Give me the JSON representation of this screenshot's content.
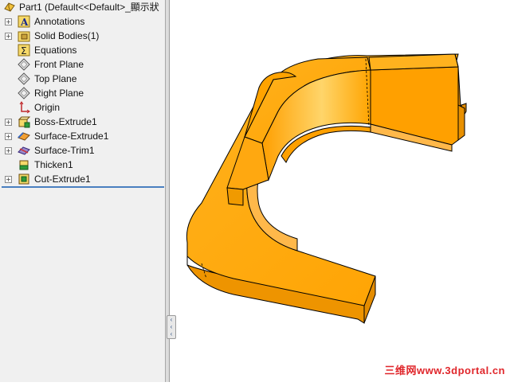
{
  "feature_tree": {
    "root": {
      "label": "Part1  (Default<<Default>_顯示狀"
    },
    "items": [
      {
        "label": "Annotations",
        "icon": "annotations-icon",
        "expandable": true
      },
      {
        "label": "Solid Bodies(1)",
        "icon": "solid-bodies-folder-icon",
        "expandable": true
      },
      {
        "label": "Equations",
        "icon": "equations-icon",
        "expandable": false
      },
      {
        "label": "Front Plane",
        "icon": "plane-icon",
        "expandable": false
      },
      {
        "label": "Top Plane",
        "icon": "plane-icon",
        "expandable": false
      },
      {
        "label": "Right Plane",
        "icon": "plane-icon",
        "expandable": false
      },
      {
        "label": "Origin",
        "icon": "origin-icon",
        "expandable": false
      },
      {
        "label": "Boss-Extrude1",
        "icon": "boss-extrude-icon",
        "expandable": true
      },
      {
        "label": "Surface-Extrude1",
        "icon": "surface-extrude-icon",
        "expandable": true
      },
      {
        "label": "Surface-Trim1",
        "icon": "surface-trim-icon",
        "expandable": true
      },
      {
        "label": "Thicken1",
        "icon": "thicken-icon",
        "expandable": false
      },
      {
        "label": "Cut-Extrude1",
        "icon": "cut-extrude-icon",
        "expandable": true
      }
    ]
  },
  "viewport": {
    "part_color": "#ffa500",
    "watermark": "三维网www.3dportal.cn"
  },
  "colors": {
    "panel_bg": "#f0f0f0",
    "rollback_bar": "#4a7fc0",
    "watermark": "#e0262b"
  }
}
